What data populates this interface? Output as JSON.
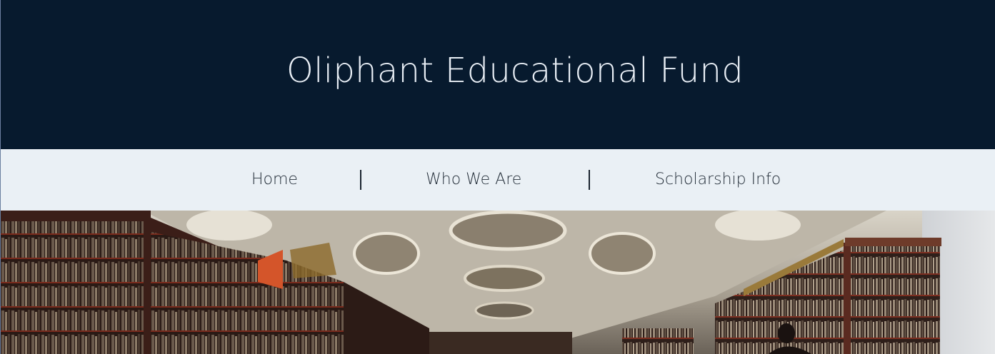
{
  "site": {
    "title": "Oliphant Educational Fund"
  },
  "nav": {
    "items": [
      {
        "label": "Home"
      },
      {
        "label": "Who We Are"
      },
      {
        "label": "Scholarship Info"
      }
    ]
  },
  "hero": {
    "image": "library-interior-photo"
  },
  "colors": {
    "header_bg": "#071a2e",
    "title_text": "#e9eff6",
    "nav_bg": "#eaf0f5",
    "nav_text": "#26303b"
  }
}
